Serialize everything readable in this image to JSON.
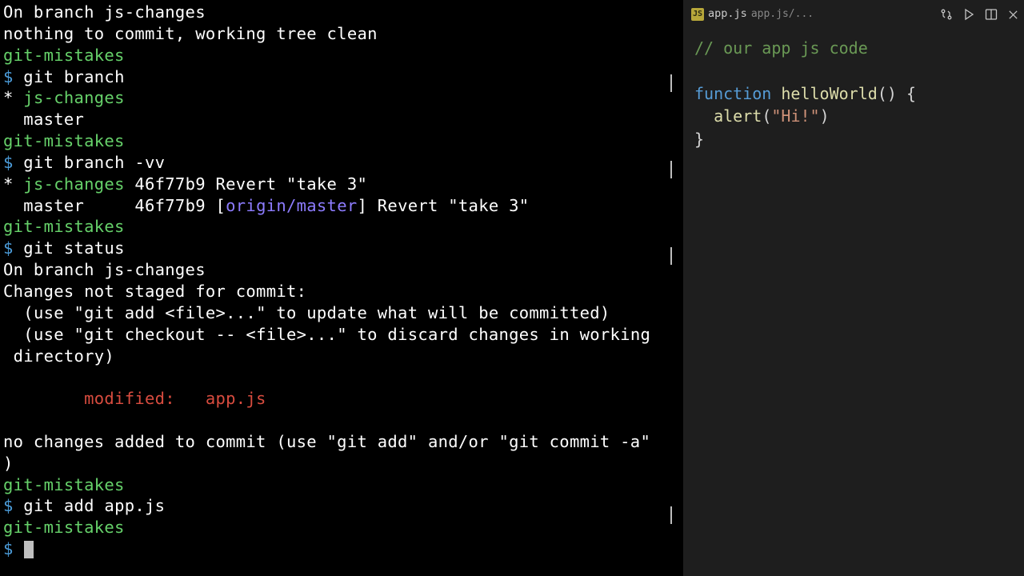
{
  "terminal": {
    "lines": [
      {
        "segs": [
          {
            "t": "On branch js-changes"
          }
        ]
      },
      {
        "segs": [
          {
            "t": "nothing to commit, working tree clean"
          }
        ]
      },
      {
        "segs": [
          {
            "t": "git-mistakes",
            "cls": "c-green"
          }
        ]
      },
      {
        "segs": [
          {
            "t": "$",
            "cls": "c-prompt"
          },
          {
            "t": " git branch"
          }
        ]
      },
      {
        "segs": [
          {
            "t": "* "
          },
          {
            "t": "js-changes",
            "cls": "c-green"
          }
        ]
      },
      {
        "segs": [
          {
            "t": "  master"
          }
        ]
      },
      {
        "segs": [
          {
            "t": "git-mistakes",
            "cls": "c-green"
          }
        ]
      },
      {
        "segs": [
          {
            "t": "$",
            "cls": "c-prompt"
          },
          {
            "t": " git branch -vv"
          }
        ]
      },
      {
        "segs": [
          {
            "t": "* "
          },
          {
            "t": "js-changes",
            "cls": "c-green"
          },
          {
            "t": " 46f77b9 Revert \"take 3\""
          }
        ]
      },
      {
        "segs": [
          {
            "t": "  master     46f77b9 ["
          },
          {
            "t": "origin/master",
            "cls": "c-remote"
          },
          {
            "t": "] Revert \"take 3\""
          }
        ]
      },
      {
        "segs": [
          {
            "t": "git-mistakes",
            "cls": "c-green"
          }
        ]
      },
      {
        "segs": [
          {
            "t": "$",
            "cls": "c-prompt"
          },
          {
            "t": " git status"
          }
        ]
      },
      {
        "segs": [
          {
            "t": "On branch js-changes"
          }
        ]
      },
      {
        "segs": [
          {
            "t": "Changes not staged for commit:"
          }
        ]
      },
      {
        "segs": [
          {
            "t": "  (use \"git add <file>...\" to update what will be committed)"
          }
        ]
      },
      {
        "segs": [
          {
            "t": "  (use \"git checkout -- <file>...\" to discard changes in working"
          }
        ]
      },
      {
        "segs": [
          {
            "t": " directory)"
          }
        ]
      },
      {
        "segs": [
          {
            "t": " "
          }
        ]
      },
      {
        "segs": [
          {
            "t": "        modified:   app.js",
            "cls": "c-red"
          }
        ]
      },
      {
        "segs": [
          {
            "t": " "
          }
        ]
      },
      {
        "segs": [
          {
            "t": "no changes added to commit (use \"git add\" and/or \"git commit -a\""
          }
        ]
      },
      {
        "segs": [
          {
            "t": ")"
          }
        ]
      },
      {
        "segs": [
          {
            "t": "git-mistakes",
            "cls": "c-green"
          }
        ]
      },
      {
        "segs": [
          {
            "t": "$",
            "cls": "c-prompt"
          },
          {
            "t": " git add app.js"
          }
        ]
      },
      {
        "segs": [
          {
            "t": "git-mistakes",
            "cls": "c-green"
          }
        ]
      },
      {
        "segs": [
          {
            "t": "$",
            "cls": "c-prompt"
          },
          {
            "t": " "
          }
        ],
        "cursor": true
      }
    ],
    "hints": [
      93,
      201,
      309,
      633
    ]
  },
  "editor": {
    "tab": {
      "badge": "JS",
      "filename": "app.js",
      "path": "app.js/..."
    },
    "code": {
      "l1_comment": "// our app js code",
      "l3_kw": "function",
      "l3_fn": "helloWorld",
      "l3_rest": "() {",
      "l4_indent": "  ",
      "l4_fn": "alert",
      "l4_open": "(",
      "l4_str": "\"Hi!\"",
      "l4_close": ")",
      "l5": "}"
    }
  }
}
